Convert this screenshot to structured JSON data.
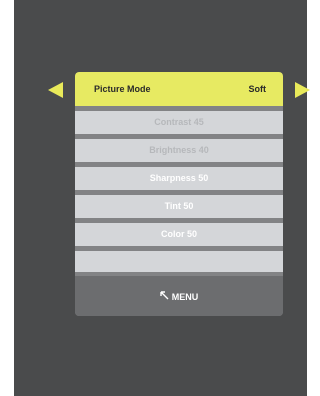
{
  "picture_mode": {
    "label": "Picture Mode",
    "value": "Soft"
  },
  "settings": [
    {
      "label": "Contrast 45",
      "state": "disabled"
    },
    {
      "label": "Brightness 40",
      "state": "disabled"
    },
    {
      "label": "Sharpness 50",
      "state": "enabled"
    },
    {
      "label": "Tint 50",
      "state": "enabled"
    },
    {
      "label": "Color 50",
      "state": "enabled"
    }
  ],
  "footer": {
    "menu_label": "MENU",
    "menu_icon": "back-arrow-icon"
  },
  "colors": {
    "highlight": "#e7ea62",
    "arrow": "#e9ea5a",
    "background": "#4a4b4c",
    "row": "#d4d6d9",
    "footer": "#6c6d6f"
  }
}
